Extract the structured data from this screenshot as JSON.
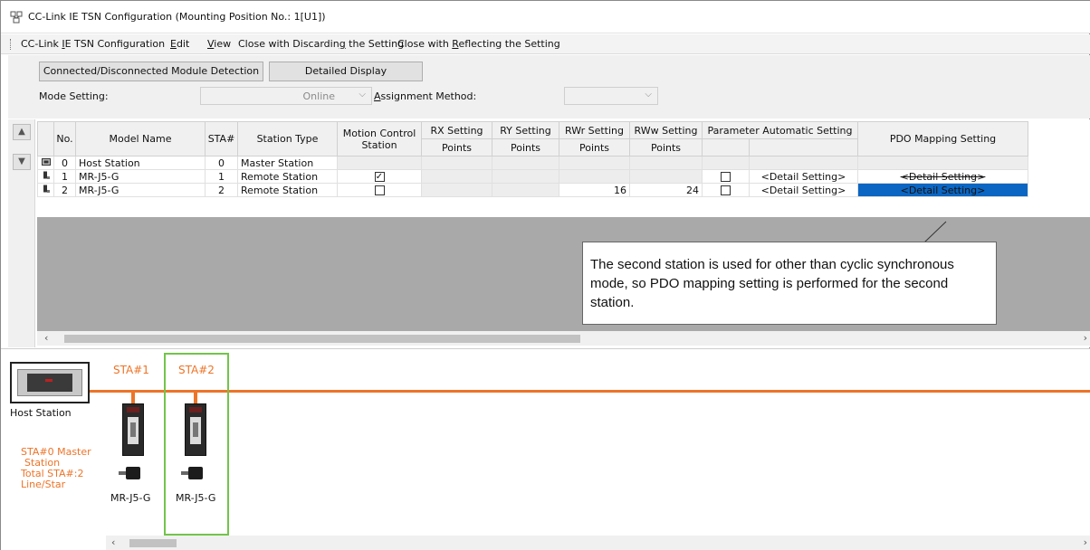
{
  "window": {
    "title": "CC-Link IE TSN Configuration (Mounting Position No.: 1[U1])"
  },
  "menu": {
    "items": [
      "CC-Link IE TSN Configuration",
      "Edit",
      "View",
      "Close with Discarding the Setting",
      "Close with Reflecting the Setting"
    ]
  },
  "toolbar": {
    "detect_button": "Connected/Disconnected Module Detection",
    "detail_button": "Detailed Display",
    "mode_label": "Mode Setting:",
    "mode_value": "Online",
    "assign_label": "Assignment Method:",
    "assign_value": ""
  },
  "table": {
    "headers": {
      "no": "No.",
      "model": "Model Name",
      "sta": "STA#",
      "type": "Station Type",
      "motion": "Motion Control Station",
      "rx": "RX Setting",
      "ry": "RY Setting",
      "rwr": "RWr Setting",
      "rww": "RWw Setting",
      "points": "Points",
      "param": "Parameter Automatic Setting",
      "pdo": "PDO Mapping Setting"
    },
    "rows": [
      {
        "no": "0",
        "model": "Host Station",
        "sta": "0",
        "type": "Master Station",
        "motion": "",
        "rwr": "",
        "rww": "",
        "detail": "",
        "pdo": ""
      },
      {
        "no": "1",
        "model": "MR-J5-G",
        "sta": "1",
        "type": "Remote Station",
        "motion": "checked",
        "rwr": "",
        "rww": "",
        "detail": "<Detail Setting>",
        "pdo": "<Detail Setting>"
      },
      {
        "no": "2",
        "model": "MR-J5-G",
        "sta": "2",
        "type": "Remote Station",
        "motion": "unchecked",
        "rwr": "16",
        "rww": "24",
        "detail": "<Detail Setting>",
        "pdo": "<Detail Setting>"
      }
    ]
  },
  "callout": {
    "text": "The second station is used for other than cyclic synchronous mode, so PDO mapping setting is performed for the second station."
  },
  "diagram": {
    "host_label": "Host Station",
    "sta1_header": "STA#1",
    "sta2_header": "STA#2",
    "info_line1": "STA#0  Master",
    "info_line2": "Station",
    "info_line3": "Total STA#:2",
    "info_line4": "Line/Star",
    "device1_label": "MR-J5-G",
    "device2_label": "MR-J5-G"
  },
  "colors": {
    "network_line": "#ed7428",
    "selection_frame": "#72c44a",
    "selected_cell": "#0a66c2",
    "link_text": "#1f3fa3"
  }
}
